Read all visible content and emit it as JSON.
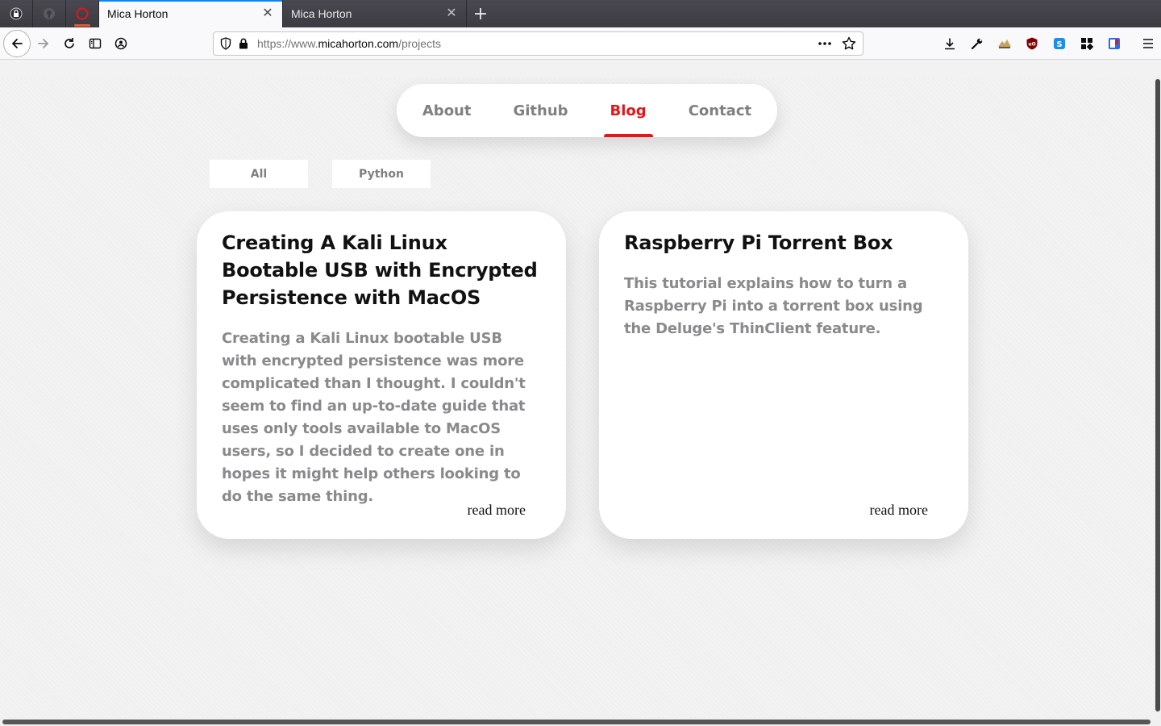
{
  "browser": {
    "tabs": [
      {
        "title": "Mica Horton",
        "selected": true
      },
      {
        "title": "Mica Horton",
        "selected": false
      }
    ],
    "close_glyph": "✕",
    "newtab_glyph": "+",
    "url": {
      "scheme": "https://www.",
      "host": "micahorton.com",
      "path": "/projects"
    },
    "icons": {
      "back": "back-arrow-icon",
      "forward": "forward-arrow-icon",
      "reload": "reload-icon",
      "sidebar": "sidebar-icon",
      "account": "account-icon",
      "shield": "tracking-shield-icon",
      "lock": "lock-icon",
      "more": "more-dots-icon",
      "bookmark": "star-icon",
      "download": "download-icon",
      "tools": "wrench-icon",
      "menu": "hamburger-menu-icon"
    }
  },
  "site": {
    "nav": {
      "items": [
        {
          "label": "About",
          "active": false
        },
        {
          "label": "Github",
          "active": false
        },
        {
          "label": "Blog",
          "active": true
        },
        {
          "label": "Contact",
          "active": false
        }
      ]
    },
    "filters": [
      "All",
      "Python"
    ],
    "cards": [
      {
        "title": "Creating A Kali Linux Bootable USB with Encrypted Persistence with MacOS",
        "description": "Creating a Kali Linux bootable USB with encrypted persistence was more complicated than I thought. I couldn't seem to find an up-to-date guide that uses only tools available to MacOS users, so I decided to create one in hopes it might help others looking to do the same thing.",
        "link": "read more"
      },
      {
        "title": "Raspberry Pi Torrent Box",
        "description": "This tutorial explains how to turn a Raspberry Pi into a torrent box using the Deluge's ThinClient feature.",
        "link": "read more"
      }
    ]
  },
  "colors": {
    "accent": "#e8131b",
    "tab_indicator": "#0a84ff",
    "muted_text": "#8a8a8e"
  }
}
